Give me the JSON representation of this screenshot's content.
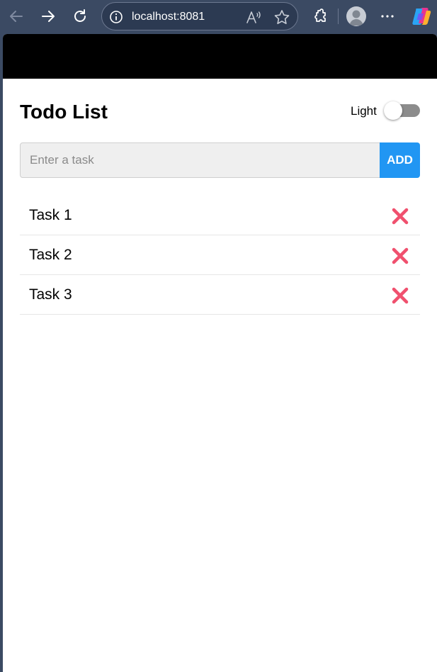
{
  "browser": {
    "url": "localhost:8081",
    "icons": [
      "back-icon",
      "forward-icon",
      "refresh-icon",
      "site-info-icon",
      "read-aloud-icon",
      "favorite-star-icon",
      "extensions-icon",
      "profile-avatar-icon",
      "more-options-icon",
      "copilot-icon"
    ]
  },
  "app": {
    "title": "Todo List",
    "theme_label": "Light",
    "theme_dark_enabled": false,
    "input_placeholder": "Enter a task",
    "input_value": "",
    "add_label": "ADD",
    "accent_color": "#2196f3",
    "delete_icon_color": "#f0506e",
    "tasks": [
      {
        "text": "Task 1",
        "delete_icon": "cross-mark-icon"
      },
      {
        "text": "Task 2",
        "delete_icon": "cross-mark-icon"
      },
      {
        "text": "Task 3",
        "delete_icon": "cross-mark-icon"
      }
    ]
  }
}
